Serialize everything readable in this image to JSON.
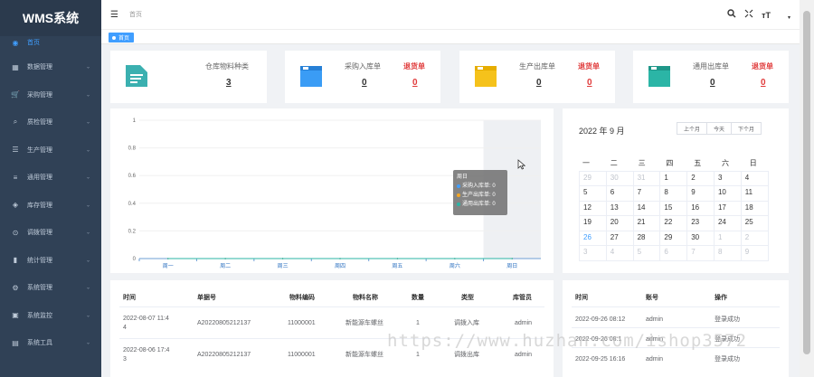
{
  "app": {
    "title": "WMS系统"
  },
  "sidebar": {
    "items": [
      {
        "label": "首页",
        "icon": "dashboard-icon"
      },
      {
        "label": "数据管理",
        "icon": "grid-icon"
      },
      {
        "label": "采购管理",
        "icon": "cart-icon"
      },
      {
        "label": "质检管理",
        "icon": "search-icon"
      },
      {
        "label": "生产管理",
        "icon": "sliders-icon"
      },
      {
        "label": "通用管理",
        "icon": "list-icon"
      },
      {
        "label": "库存管理",
        "icon": "layers-icon"
      },
      {
        "label": "调拨管理",
        "icon": "transfer-icon"
      },
      {
        "label": "统计管理",
        "icon": "bar-chart-icon"
      },
      {
        "label": "系统管理",
        "icon": "gear-icon"
      },
      {
        "label": "系统监控",
        "icon": "monitor-icon"
      },
      {
        "label": "系统工具",
        "icon": "toolbox-icon"
      }
    ]
  },
  "header": {
    "breadcrumb": "首页"
  },
  "tags": {
    "active": "首页"
  },
  "cards": [
    {
      "label": "仓库物料种类",
      "value": "3",
      "color": "#3bb0b0"
    },
    {
      "label": "采购入库单",
      "value": "0",
      "return_label": "退货单",
      "return_value": "0",
      "color": "#3a9cf5"
    },
    {
      "label": "生产出库单",
      "value": "0",
      "return_label": "退货单",
      "return_value": "0",
      "color": "#f5c21b"
    },
    {
      "label": "通用出库单",
      "value": "0",
      "return_label": "退货单",
      "return_value": "0",
      "color": "#2bb5a6"
    }
  ],
  "chart_data": {
    "type": "line",
    "categories": [
      "周一",
      "周二",
      "周三",
      "周四",
      "周五",
      "周六",
      "周日"
    ],
    "series": [
      {
        "name": "采购入库单",
        "values": [
          0,
          0,
          0,
          0,
          0,
          0,
          0
        ],
        "color": "#409eff"
      },
      {
        "name": "生产出库单",
        "values": [
          0,
          0,
          0,
          0,
          0,
          0,
          0
        ],
        "color": "#f5a623"
      },
      {
        "name": "通用出库单",
        "values": [
          0,
          0,
          0,
          0,
          0,
          0,
          0
        ],
        "color": "#2bb5a6"
      }
    ],
    "yticks": [
      "0",
      "0.2",
      "0.4",
      "0.6",
      "0.8",
      "1"
    ],
    "ylim": [
      0,
      1
    ],
    "tooltip": {
      "title": "周日",
      "rows": [
        "采购入库单: 0",
        "生产出库单: 0",
        "通用出库单: 0"
      ]
    }
  },
  "calendar": {
    "title": "2022 年 9 月",
    "buttons": [
      "上个月",
      "今天",
      "下个月"
    ],
    "weekdays": [
      "一",
      "二",
      "三",
      "四",
      "五",
      "六",
      "日"
    ],
    "weeks": [
      [
        "29",
        "30",
        "31",
        "1",
        "2",
        "3",
        "4"
      ],
      [
        "5",
        "6",
        "7",
        "8",
        "9",
        "10",
        "11"
      ],
      [
        "12",
        "13",
        "14",
        "15",
        "16",
        "17",
        "18"
      ],
      [
        "19",
        "20",
        "21",
        "22",
        "23",
        "24",
        "25"
      ],
      [
        "26",
        "27",
        "28",
        "29",
        "30",
        "1",
        "2"
      ],
      [
        "3",
        "4",
        "5",
        "6",
        "7",
        "8",
        "9"
      ]
    ]
  },
  "left_table": {
    "headers": [
      "时间",
      "单据号",
      "物料编码",
      "物料名称",
      "数量",
      "类型",
      "库管员"
    ],
    "rows": [
      [
        "2022-08-07 11:4",
        "4",
        "A20220805212137",
        "11000001",
        "新能源车螺丝",
        "1",
        "调拨入库",
        "admin"
      ],
      [
        "2022-08-06 17:4",
        "3",
        "A20220805212137",
        "11000001",
        "新能源车螺丝",
        "1",
        "调拨出库",
        "admin"
      ]
    ]
  },
  "right_table": {
    "headers": [
      "时间",
      "账号",
      "操作"
    ],
    "rows": [
      [
        "2022-09-26 08:12",
        "admin",
        "登录成功"
      ],
      [
        "2022-09-26 08:1",
        "admin",
        "登录成功"
      ],
      [
        "2022-09-25 16:16",
        "admin",
        "登录成功"
      ]
    ]
  },
  "watermark": "https://www.huzhan.com/ishop3572"
}
